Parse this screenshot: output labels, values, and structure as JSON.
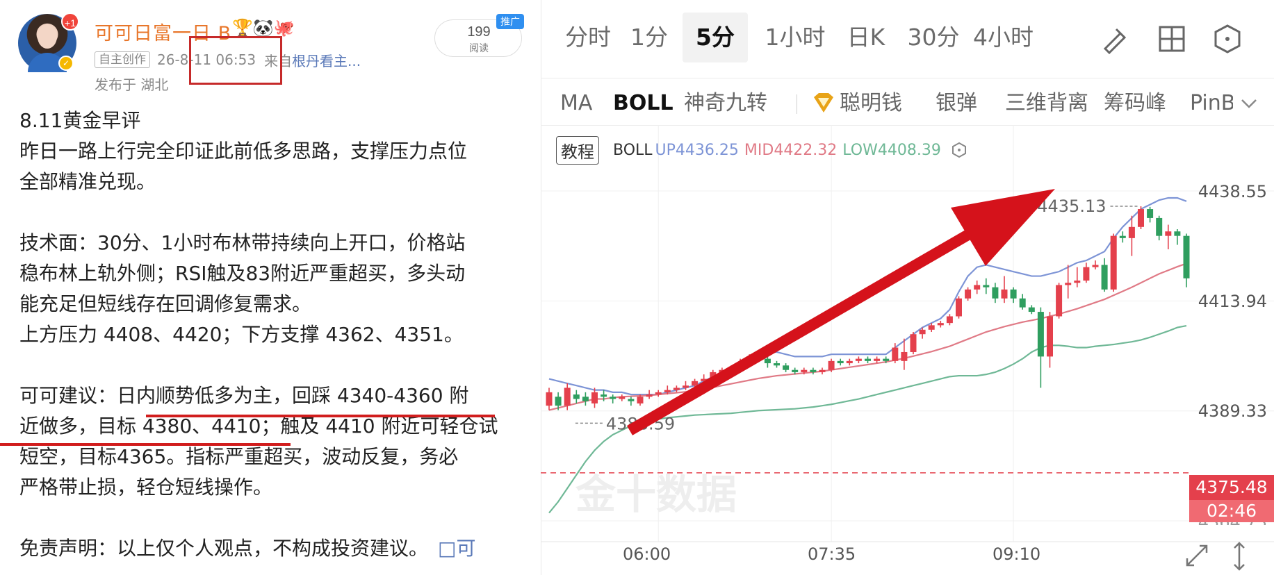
{
  "post": {
    "author": "可可日富一日 B",
    "avatar_notification": "+1",
    "tag_original": "自主创作",
    "timestamp": "26-8-11 06:53",
    "source_prefix": "来自",
    "source_name": "根丹看主...",
    "location": "发布于 湖北",
    "read_count": "199",
    "read_label": "阅读",
    "ad_label": "推广",
    "lines": {
      "l1": "8.11黄金早评",
      "l2": "昨日一路上行完全印证此前低多思路，支撑压力点位",
      "l3": "全部精准兑现。",
      "l4": "技术面：30分、1小时布林带持续向上开口，价格站",
      "l5": "稳布林上轨外侧；RSI触及83附近严重超买，多头动",
      "l6": "能充足但短线存在回调修复需求。",
      "l7": "上方压力 4408、4420；下方支撑 4362、4351。",
      "l8": "可可建议：日内顺势低多为主，回踩 4340-4360 附",
      "l9": "近做多，目标 4380、4410；触及 4410 附近可轻仓试",
      "l10": "短空，目标4365。指标严重超买，波动反复，务必",
      "l11": "严格带止损，轻仓短线操作。",
      "l12": "免责声明：以上仅个人观点，不构成投资建议。",
      "share": "□可"
    }
  },
  "panel": {
    "tabs": [
      "分时",
      "1分",
      "5分",
      "1小时",
      "日K",
      "30分",
      "4小时"
    ],
    "active_tab": "5分",
    "tools": [
      "draw-icon",
      "grid-icon",
      "settings-icon"
    ],
    "indicators": [
      "MA",
      "BOLL",
      "神奇九转",
      "聪明钱",
      "银弹",
      "三维背离",
      "筹码峰",
      "PinB"
    ],
    "active_indicator": "BOLL",
    "legend": {
      "tutorial": "教程",
      "name": "BOLL",
      "up": "UP4436.25",
      "mid": "MID4422.32",
      "low": "LOW4408.39"
    },
    "watermark": "金十数据"
  },
  "chart_data": {
    "type": "candlestick",
    "title": "",
    "indicator": "BOLL",
    "y_axis_labels": [
      "4438.55",
      "4413.94",
      "4389.33",
      "4364.73"
    ],
    "ylim": [
      4364.73,
      4438.55
    ],
    "x_axis_labels": [
      "06:00",
      "07:35",
      "09:10"
    ],
    "annotations": {
      "high": "4435.13",
      "low": "4386.59",
      "current_price": "4375.48",
      "countdown": "02:46"
    },
    "candles": [
      {
        "o": 4390.5,
        "c": 4393.5,
        "h": 4394.5,
        "l": 4389.5
      },
      {
        "o": 4392.5,
        "c": 4390.5,
        "h": 4393.5,
        "l": 4389.5
      },
      {
        "o": 4390.5,
        "c": 4394.5,
        "h": 4395.5,
        "l": 4389.5
      },
      {
        "o": 4393.0,
        "c": 4392.0,
        "h": 4394.0,
        "l": 4391.0
      },
      {
        "o": 4392.5,
        "c": 4391.5,
        "h": 4393.5,
        "l": 4390.5
      },
      {
        "o": 4391.0,
        "c": 4393.5,
        "h": 4394.5,
        "l": 4390.0
      },
      {
        "o": 4393.0,
        "c": 4392.5,
        "h": 4394.0,
        "l": 4391.5
      },
      {
        "o": 4392.5,
        "c": 4392.0,
        "h": 4393.0,
        "l": 4391.0
      },
      {
        "o": 4392.0,
        "c": 4392.5,
        "h": 4393.0,
        "l": 4391.5
      },
      {
        "o": 4392.0,
        "c": 4391.5,
        "h": 4392.5,
        "l": 4390.5
      },
      {
        "o": 4391.0,
        "c": 4392.5,
        "h": 4393.0,
        "l": 4390.5
      },
      {
        "o": 4392.5,
        "c": 4393.0,
        "h": 4394.0,
        "l": 4392.0
      },
      {
        "o": 4393.0,
        "c": 4393.5,
        "h": 4394.0,
        "l": 4392.5
      },
      {
        "o": 4393.5,
        "c": 4394.0,
        "h": 4395.0,
        "l": 4393.0
      },
      {
        "o": 4394.0,
        "c": 4394.5,
        "h": 4395.0,
        "l": 4393.5
      },
      {
        "o": 4394.5,
        "c": 4395.0,
        "h": 4396.0,
        "l": 4394.0
      },
      {
        "o": 4395.0,
        "c": 4396.0,
        "h": 4396.5,
        "l": 4394.5
      },
      {
        "o": 4396.0,
        "c": 4396.5,
        "h": 4397.5,
        "l": 4395.5
      },
      {
        "o": 4396.5,
        "c": 4398.0,
        "h": 4398.5,
        "l": 4396.0
      },
      {
        "o": 4398.0,
        "c": 4398.5,
        "h": 4399.0,
        "l": 4397.5
      },
      {
        "o": 4398.5,
        "c": 4399.0,
        "h": 4399.5,
        "l": 4398.0
      },
      {
        "o": 4399.0,
        "c": 4400.0,
        "h": 4401.0,
        "l": 4398.5
      },
      {
        "o": 4400.0,
        "c": 4401.5,
        "h": 4402.0,
        "l": 4399.5
      },
      {
        "o": 4401.5,
        "c": 4401.0,
        "h": 4402.5,
        "l": 4400.5
      },
      {
        "o": 4401.0,
        "c": 4400.0,
        "h": 4401.5,
        "l": 4399.0
      },
      {
        "o": 4400.0,
        "c": 4399.5,
        "h": 4400.5,
        "l": 4399.0
      },
      {
        "o": 4399.5,
        "c": 4398.5,
        "h": 4400.0,
        "l": 4398.0
      },
      {
        "o": 4398.5,
        "c": 4398.0,
        "h": 4399.0,
        "l": 4397.5
      },
      {
        "o": 4398.0,
        "c": 4398.5,
        "h": 4399.0,
        "l": 4397.5
      },
      {
        "o": 4398.5,
        "c": 4398.0,
        "h": 4399.0,
        "l": 4397.5
      },
      {
        "o": 4398.0,
        "c": 4398.5,
        "h": 4399.0,
        "l": 4397.5
      },
      {
        "o": 4398.5,
        "c": 4400.5,
        "h": 4401.0,
        "l": 4398.0
      },
      {
        "o": 4400.5,
        "c": 4400.0,
        "h": 4401.0,
        "l": 4399.5
      },
      {
        "o": 4400.0,
        "c": 4400.5,
        "h": 4401.0,
        "l": 4399.5
      },
      {
        "o": 4400.5,
        "c": 4401.0,
        "h": 4401.5,
        "l": 4400.0
      },
      {
        "o": 4401.0,
        "c": 4400.5,
        "h": 4401.5,
        "l": 4400.0
      },
      {
        "o": 4400.5,
        "c": 4401.0,
        "h": 4401.5,
        "l": 4400.0
      },
      {
        "o": 4401.0,
        "c": 4400.5,
        "h": 4401.5,
        "l": 4400.0
      },
      {
        "o": 4400.5,
        "c": 4403.5,
        "h": 4404.5,
        "l": 4400.0
      },
      {
        "o": 4400.5,
        "c": 4402.5,
        "h": 4405.5,
        "l": 4398.5
      },
      {
        "o": 4402.5,
        "c": 4406.5,
        "h": 4407.0,
        "l": 4402.0
      },
      {
        "o": 4406.5,
        "c": 4407.5,
        "h": 4408.0,
        "l": 4405.5
      },
      {
        "o": 4407.5,
        "c": 4408.5,
        "h": 4409.0,
        "l": 4407.0
      },
      {
        "o": 4408.5,
        "c": 4409.0,
        "h": 4409.5,
        "l": 4408.0
      },
      {
        "o": 4409.0,
        "c": 4410.5,
        "h": 4411.0,
        "l": 4408.5
      },
      {
        "o": 4410.5,
        "c": 4414.5,
        "h": 4415.0,
        "l": 4410.0
      },
      {
        "o": 4414.5,
        "c": 4416.5,
        "h": 4417.0,
        "l": 4414.0
      },
      {
        "o": 4416.5,
        "c": 4417.5,
        "h": 4418.5,
        "l": 4415.5
      },
      {
        "o": 4417.5,
        "c": 4417.0,
        "h": 4419.0,
        "l": 4415.5
      },
      {
        "o": 4417.0,
        "c": 4414.5,
        "h": 4418.0,
        "l": 4413.5
      },
      {
        "o": 4414.5,
        "c": 4416.5,
        "h": 4419.5,
        "l": 4413.5
      },
      {
        "o": 4416.5,
        "c": 4414.5,
        "h": 4417.0,
        "l": 4413.5
      },
      {
        "o": 4414.5,
        "c": 4412.5,
        "h": 4415.5,
        "l": 4412.0
      },
      {
        "o": 4412.5,
        "c": 4411.5,
        "h": 4413.0,
        "l": 4411.0
      },
      {
        "o": 4411.5,
        "c": 4401.5,
        "h": 4412.5,
        "l": 4394.5
      },
      {
        "o": 4401.5,
        "c": 4410.5,
        "h": 4411.5,
        "l": 4399.0
      },
      {
        "o": 4410.5,
        "c": 4417.5,
        "h": 4418.0,
        "l": 4410.0
      },
      {
        "o": 4417.5,
        "c": 4418.0,
        "h": 4422.0,
        "l": 4414.5
      },
      {
        "o": 4418.0,
        "c": 4418.5,
        "h": 4421.5,
        "l": 4417.0
      },
      {
        "o": 4418.5,
        "c": 4421.5,
        "h": 4422.5,
        "l": 4418.0
      },
      {
        "o": 4421.5,
        "c": 4422.0,
        "h": 4423.0,
        "l": 4421.0
      },
      {
        "o": 4422.0,
        "c": 4416.5,
        "h": 4423.5,
        "l": 4416.0
      },
      {
        "o": 4416.5,
        "c": 4428.5,
        "h": 4429.0,
        "l": 4416.0
      },
      {
        "o": 4428.5,
        "c": 4428.0,
        "h": 4429.5,
        "l": 4427.0
      },
      {
        "o": 4428.0,
        "c": 4430.5,
        "h": 4433.0,
        "l": 4424.0
      },
      {
        "o": 4430.5,
        "c": 4434.5,
        "h": 4435.13,
        "l": 4430.0
      },
      {
        "o": 4434.5,
        "c": 4432.5,
        "h": 4435.0,
        "l": 4431.5
      },
      {
        "o": 4432.5,
        "c": 4428.5,
        "h": 4433.0,
        "l": 4427.5
      },
      {
        "o": 4428.5,
        "c": 4429.5,
        "h": 4431.0,
        "l": 4425.5
      },
      {
        "o": 4429.5,
        "c": 4428.5,
        "h": 4430.0,
        "l": 4426.5
      },
      {
        "o": 4428.5,
        "c": 4419.0,
        "h": 4429.0,
        "l": 4417.0
      }
    ],
    "series": [
      {
        "name": "UP",
        "color": "#7d94d6",
        "values": [
          4396.5,
          4396.0,
          4395.5,
          4395.0,
          4394.5,
          4394.0,
          4394.0,
          4393.5,
          4393.5,
          4393.0,
          4393.0,
          4393.0,
          4393.0,
          4393.5,
          4394.0,
          4394.5,
          4395.0,
          4396.0,
          4397.0,
          4398.0,
          4399.0,
          4400.0,
          4401.0,
          4402.0,
          4402.5,
          4402.5,
          4402.0,
          4401.5,
          4401.5,
          4401.5,
          4401.5,
          4402.0,
          4402.0,
          4402.0,
          4402.0,
          4402.0,
          4402.0,
          4402.0,
          4403.5,
          4405.0,
          4406.5,
          4408.0,
          4409.0,
          4410.0,
          4412.0,
          4416.0,
          4419.5,
          4421.5,
          4422.0,
          4421.5,
          4421.0,
          4420.5,
          4420.0,
          4419.5,
          4419.5,
          4420.0,
          4420.5,
          4421.5,
          4422.5,
          4423.0,
          4424.0,
          4425.0,
          4428.0,
          4430.5,
          4432.5,
          4434.5,
          4435.5,
          4436.5,
          4437.0,
          4437.0,
          4436.25
        ]
      },
      {
        "name": "MID",
        "color": "#e07a86",
        "values": [
          4389.5,
          4390.0,
          4390.5,
          4391.0,
          4391.5,
          4392.0,
          4392.0,
          4392.3,
          4392.5,
          4392.6,
          4392.7,
          4392.8,
          4393.0,
          4393.2,
          4393.4,
          4393.6,
          4393.9,
          4394.2,
          4394.6,
          4395.0,
          4395.4,
          4395.8,
          4396.2,
          4396.6,
          4396.9,
          4397.2,
          4397.4,
          4397.6,
          4397.8,
          4398.0,
          4398.2,
          4398.5,
          4398.8,
          4399.1,
          4399.4,
          4399.7,
          4400.0,
          4400.3,
          4400.7,
          4401.1,
          4401.6,
          4402.1,
          4402.6,
          4403.2,
          4403.8,
          4404.6,
          4405.4,
          4406.2,
          4407.0,
          4407.6,
          4408.2,
          4408.7,
          4409.2,
          4409.6,
          4410.0,
          4410.5,
          4411.0,
          4411.6,
          4412.2,
          4412.9,
          4413.6,
          4414.3,
          4415.2,
          4416.1,
          4417.0,
          4418.0,
          4419.0,
          4420.0,
          4420.8,
          4421.6,
          4422.32
        ]
      },
      {
        "name": "LOW",
        "color": "#6fb896",
        "values": [
          4366.5,
          4369.0,
          4372.0,
          4375.0,
          4378.0,
          4380.5,
          4382.5,
          4384.0,
          4385.0,
          4386.0,
          4386.5,
          4387.0,
          4387.5,
          4387.8,
          4388.0,
          4388.2,
          4388.4,
          4388.5,
          4388.6,
          4388.7,
          4388.8,
          4389.0,
          4389.2,
          4389.4,
          4389.5,
          4389.6,
          4389.7,
          4389.8,
          4390.0,
          4390.2,
          4390.5,
          4390.8,
          4391.2,
          4391.6,
          4392.0,
          4392.5,
          4393.0,
          4393.5,
          4394.0,
          4394.5,
          4395.0,
          4395.5,
          4396.0,
          4396.5,
          4397.0,
          4397.2,
          4397.2,
          4397.2,
          4397.5,
          4398.0,
          4398.8,
          4399.8,
          4401.0,
          4402.5,
          4403.5,
          4404.0,
          4404.0,
          4403.8,
          4403.5,
          4403.5,
          4403.8,
          4404.0,
          4404.2,
          4404.5,
          4404.8,
          4405.2,
          4405.8,
          4406.5,
          4407.2,
          4408.0,
          4408.39
        ]
      }
    ],
    "up_color": "#e4404c",
    "down_color": "#2f9e5f",
    "grid": true,
    "x_ticks": [
      {
        "label": "06:00",
        "index": 12
      },
      {
        "label": "07:35",
        "index": 31
      },
      {
        "label": "09:10",
        "index": 51
      }
    ]
  }
}
